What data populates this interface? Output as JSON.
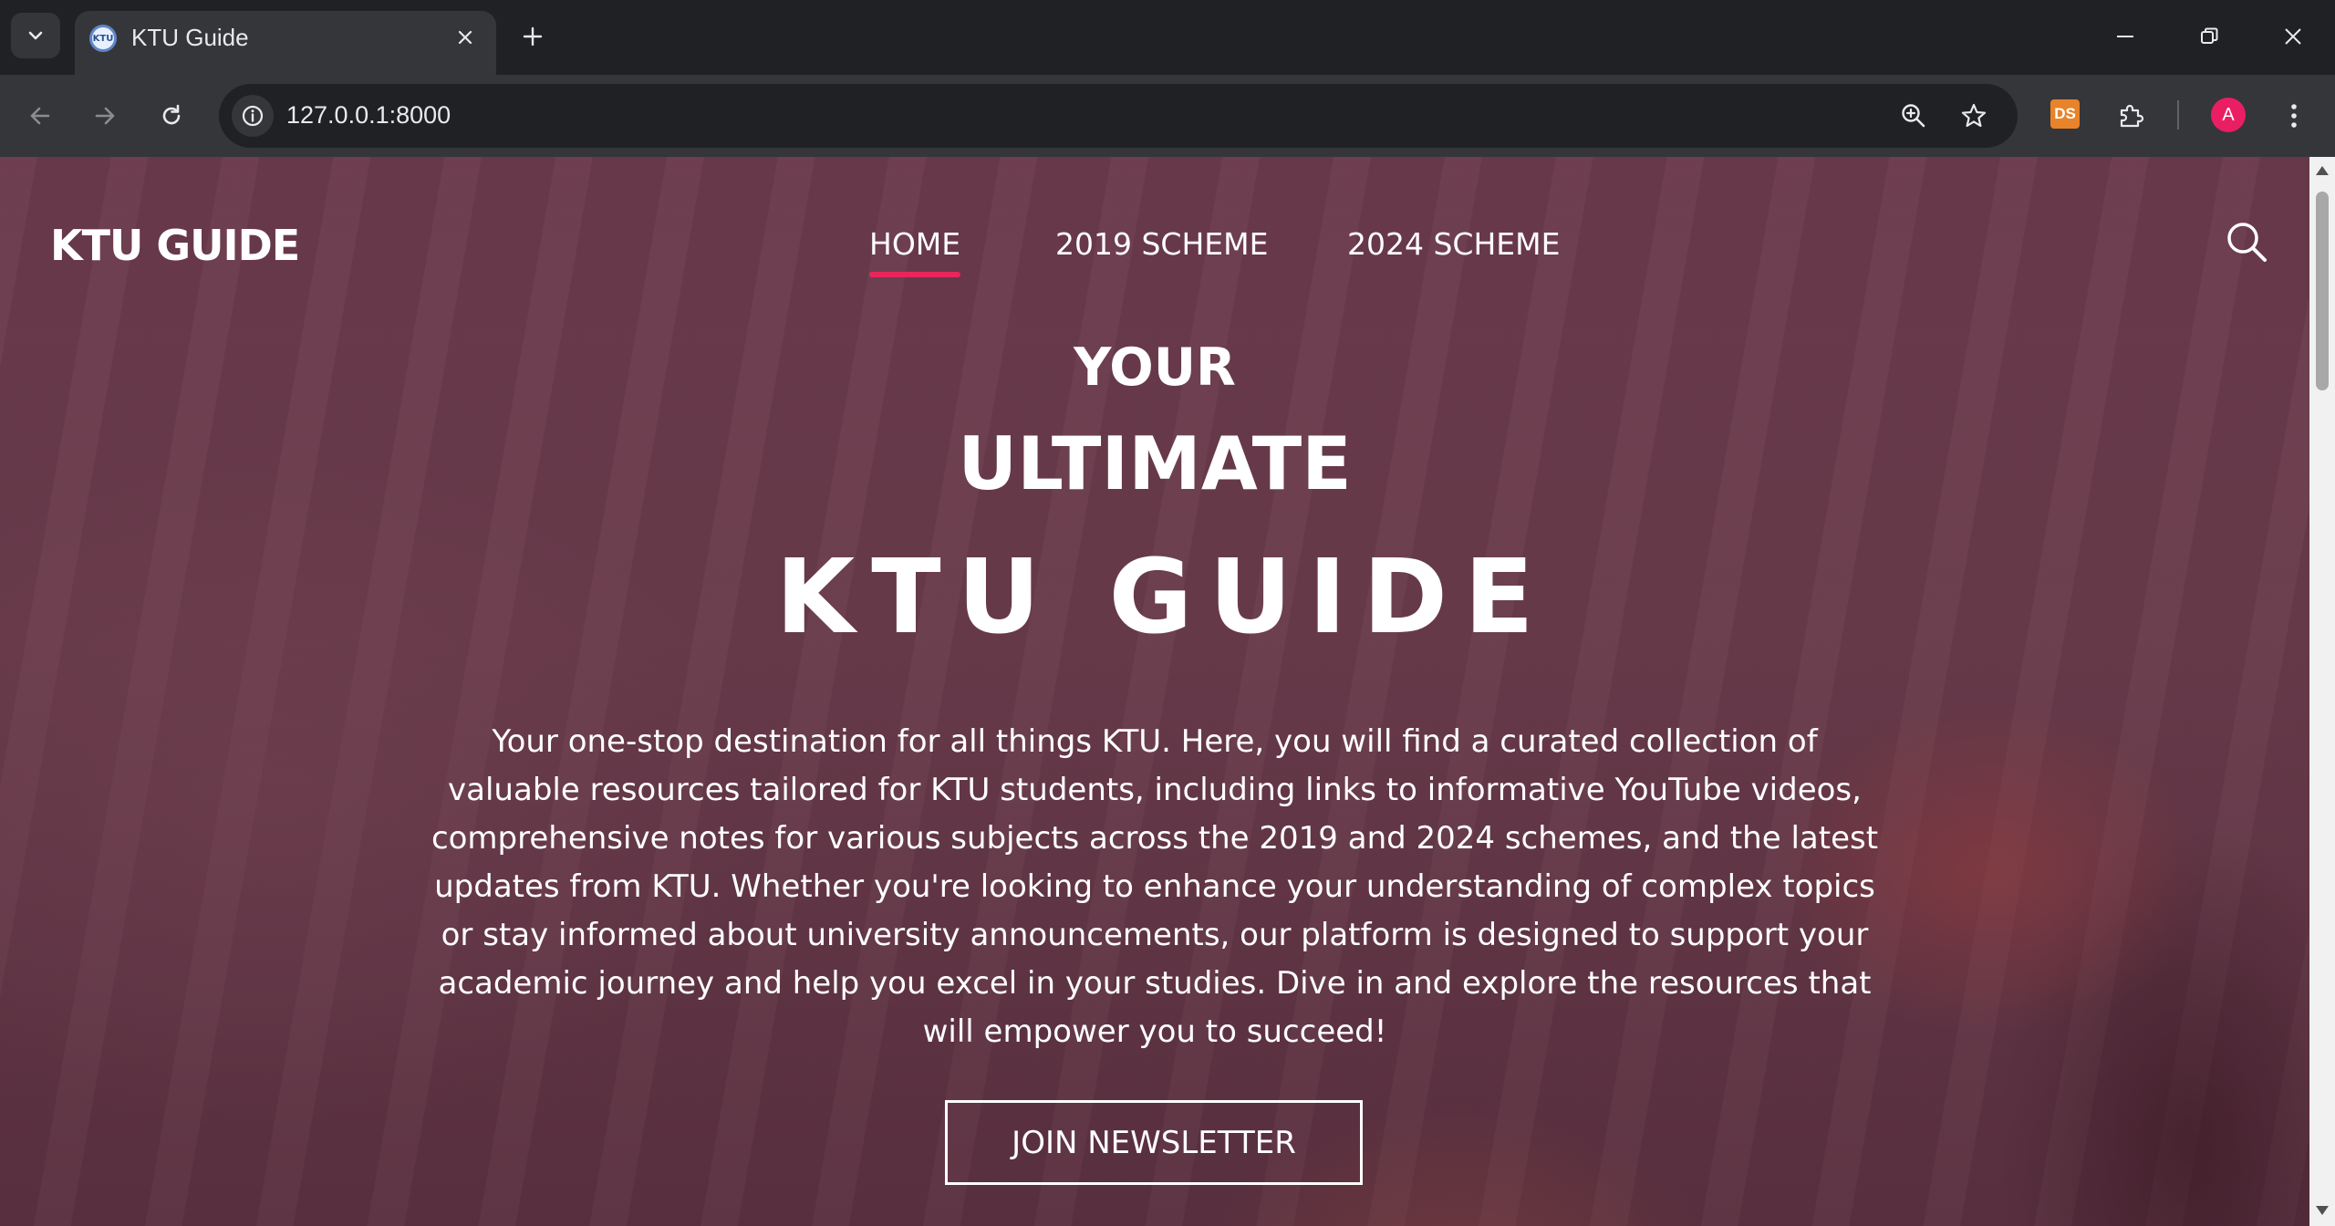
{
  "browser": {
    "tab_title": "KTU Guide",
    "favicon_text": "KTU",
    "url": "127.0.0.1:8000",
    "avatar_letter": "A",
    "extension_ds_label": "DS"
  },
  "site": {
    "logo": "KTU GUIDE",
    "nav": [
      {
        "label": "HOME",
        "active": true
      },
      {
        "label": "2019 SCHEME",
        "active": false
      },
      {
        "label": "2024 SCHEME",
        "active": false
      }
    ],
    "accent_color": "#e8265a"
  },
  "hero": {
    "line1": "YOUR",
    "line2": "ULTIMATE",
    "line3": "KTU GUIDE",
    "description_lines": [
      "Your one-stop destination for all things KTU. Here, you will find a curated collection of",
      "valuable resources tailored for KTU students, including links to informative YouTube videos,",
      "comprehensive notes for various subjects across the 2019 and 2024 schemes, and the latest",
      "updates from KTU. Whether you're looking to enhance your understanding of complex topics",
      "or stay informed about university announcements, our platform is designed to support your",
      "academic journey and help you excel in your studies. Dive in and explore the resources that",
      "will empower you to succeed!"
    ],
    "cta_label": "JOIN NEWSLETTER"
  }
}
